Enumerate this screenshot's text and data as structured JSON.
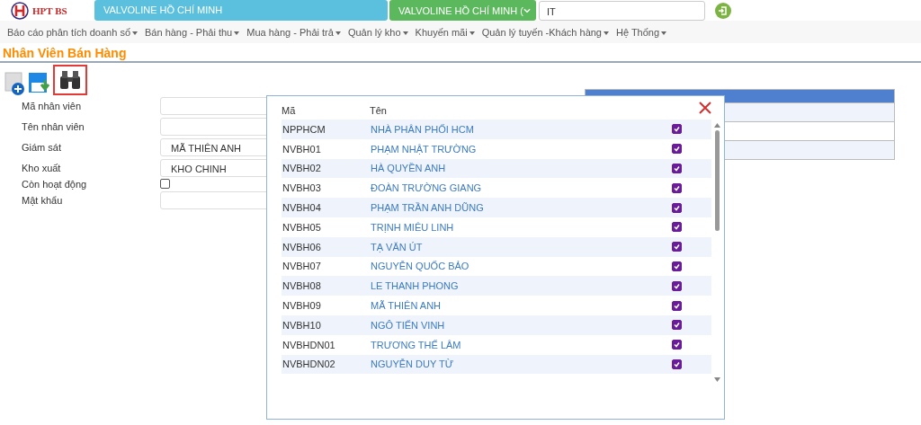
{
  "header": {
    "logo": "HPT BS",
    "company": "VALVOLINE HỒ CHÍ MINH",
    "branch": "VALVOLINE HỒ CHÍ MINH (",
    "user": "IT"
  },
  "menu": [
    {
      "label": "Báo cáo phân tích doanh số"
    },
    {
      "label": "Bán hàng - Phải thu"
    },
    {
      "label": "Mua hàng - Phải trả"
    },
    {
      "label": "Quản lý kho"
    },
    {
      "label": "Khuyến mãi"
    },
    {
      "label": "Quản lý tuyến -Khách hàng"
    },
    {
      "label": "Hệ Thống"
    }
  ],
  "page_title": "Nhân Viên Bán Hàng",
  "form": [
    {
      "kind": "text",
      "label": "Mã nhân viên"
    },
    {
      "kind": "text",
      "label": "Tên nhân viên"
    },
    {
      "kind": "text",
      "label": "Giám sát",
      "value": "MÃ THIÊN ANH"
    },
    {
      "kind": "text",
      "label": "Kho xuất",
      "value": "KHO CHINH"
    },
    {
      "kind": "check",
      "label": "Còn hoạt động",
      "checked": false
    },
    {
      "kind": "text",
      "label": "Mật khẩu"
    }
  ],
  "popup": {
    "columns": [
      "Mã",
      "Tên"
    ],
    "rows": [
      {
        "code": "NPPHCM",
        "name": "NHÀ PHÂN PHỐI HCM",
        "checked": true
      },
      {
        "code": "NVBH01",
        "name": "PHẠM NHẬT TRƯỜNG",
        "checked": true
      },
      {
        "code": "NVBH02",
        "name": "HÀ QUYỀN ANH",
        "checked": true
      },
      {
        "code": "NVBH03",
        "name": "ĐOÀN TRƯỜNG GIANG",
        "checked": true
      },
      {
        "code": "NVBH04",
        "name": "PHẠM TRẦN ANH DŨNG",
        "checked": true
      },
      {
        "code": "NVBH05",
        "name": "TRỊNH MIÊU LINH",
        "checked": true
      },
      {
        "code": "NVBH06",
        "name": "TẠ VĂN ÚT",
        "checked": true
      },
      {
        "code": "NVBH07",
        "name": "NGUYỄN QUỐC BẢO",
        "checked": true
      },
      {
        "code": "NVBH08",
        "name": "LE THANH PHONG",
        "checked": true
      },
      {
        "code": "NVBH09",
        "name": "MÃ THIÊN ANH",
        "checked": true
      },
      {
        "code": "NVBH10",
        "name": "NGÔ TIẾN VINH",
        "checked": true
      },
      {
        "code": "NVBHDN01",
        "name": "TRƯƠNG THẾ LÂM",
        "checked": true
      },
      {
        "code": "NVBHDN02",
        "name": "NGUYỄN DUY TỪ",
        "checked": true
      }
    ]
  }
}
